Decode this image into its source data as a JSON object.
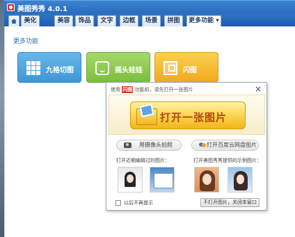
{
  "window": {
    "title": "美图秀秀 4.0.1"
  },
  "tabs": [
    {
      "label": "美化"
    },
    {
      "label": "美容"
    },
    {
      "label": "饰品"
    },
    {
      "label": "文字"
    },
    {
      "label": "边框"
    },
    {
      "label": "场景"
    },
    {
      "label": "拼图"
    },
    {
      "label": "更多功能 ▾"
    }
  ],
  "main": {
    "section_title": "更多功能",
    "features": [
      {
        "label": "九格切图",
        "icon": "grid-icon",
        "color": "#4aa3e0"
      },
      {
        "label": "摇头娃娃",
        "icon": "face-icon",
        "color": "#8cc84b"
      },
      {
        "label": "闪图",
        "icon": "flash-image-icon",
        "color": "#f6bd32"
      }
    ]
  },
  "dialog": {
    "header_prefix": "使用",
    "logo_text": "闪图",
    "header_suffix": "功能前，请先打开一张图片",
    "close_icon": "×",
    "open_button": "打开一张图片",
    "camera_button": "用摄像头拍照",
    "cloud_button": "打开百度云网盘图片",
    "recent_label": "打开近期编辑过的图片：",
    "sample_label": "打开美图秀秀提供的示例图片：",
    "checkbox_label": "以后不再提示",
    "close_button": "不打开图片，关闭本窗口"
  }
}
